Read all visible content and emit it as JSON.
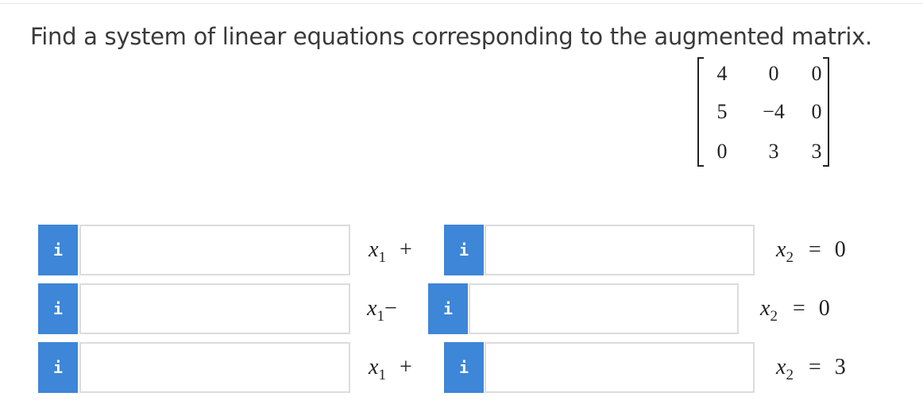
{
  "question": {
    "text": "Find a system of linear equations corresponding to the augmented matrix."
  },
  "matrix": {
    "rows": [
      [
        "4",
        "0",
        "0"
      ],
      [
        "5",
        "−4",
        "0"
      ],
      [
        "0",
        "3",
        "3"
      ]
    ]
  },
  "equations": [
    {
      "info_label": "i",
      "coef1_value": "",
      "var1": "x",
      "var1_sub": "1",
      "operator": "+",
      "coef2_value": "",
      "var2": "x",
      "var2_sub": "2",
      "equals": "=",
      "rhs": "0"
    },
    {
      "info_label": "i",
      "coef1_value": "",
      "var1": "x",
      "var1_sub": "1",
      "operator": "−",
      "coef2_value": "",
      "var2": "x",
      "var2_sub": "2",
      "equals": "=",
      "rhs": "0"
    },
    {
      "info_label": "i",
      "coef1_value": "",
      "var1": "x",
      "var1_sub": "1",
      "operator": "+",
      "coef2_value": "",
      "var2": "x",
      "var2_sub": "2",
      "equals": "=",
      "rhs": "3"
    }
  ],
  "colors": {
    "info_button": "#3d86d8",
    "field_border": "#dcdcdc",
    "question_text": "#3a3a3a"
  },
  "icons": {
    "info": "info-icon"
  }
}
